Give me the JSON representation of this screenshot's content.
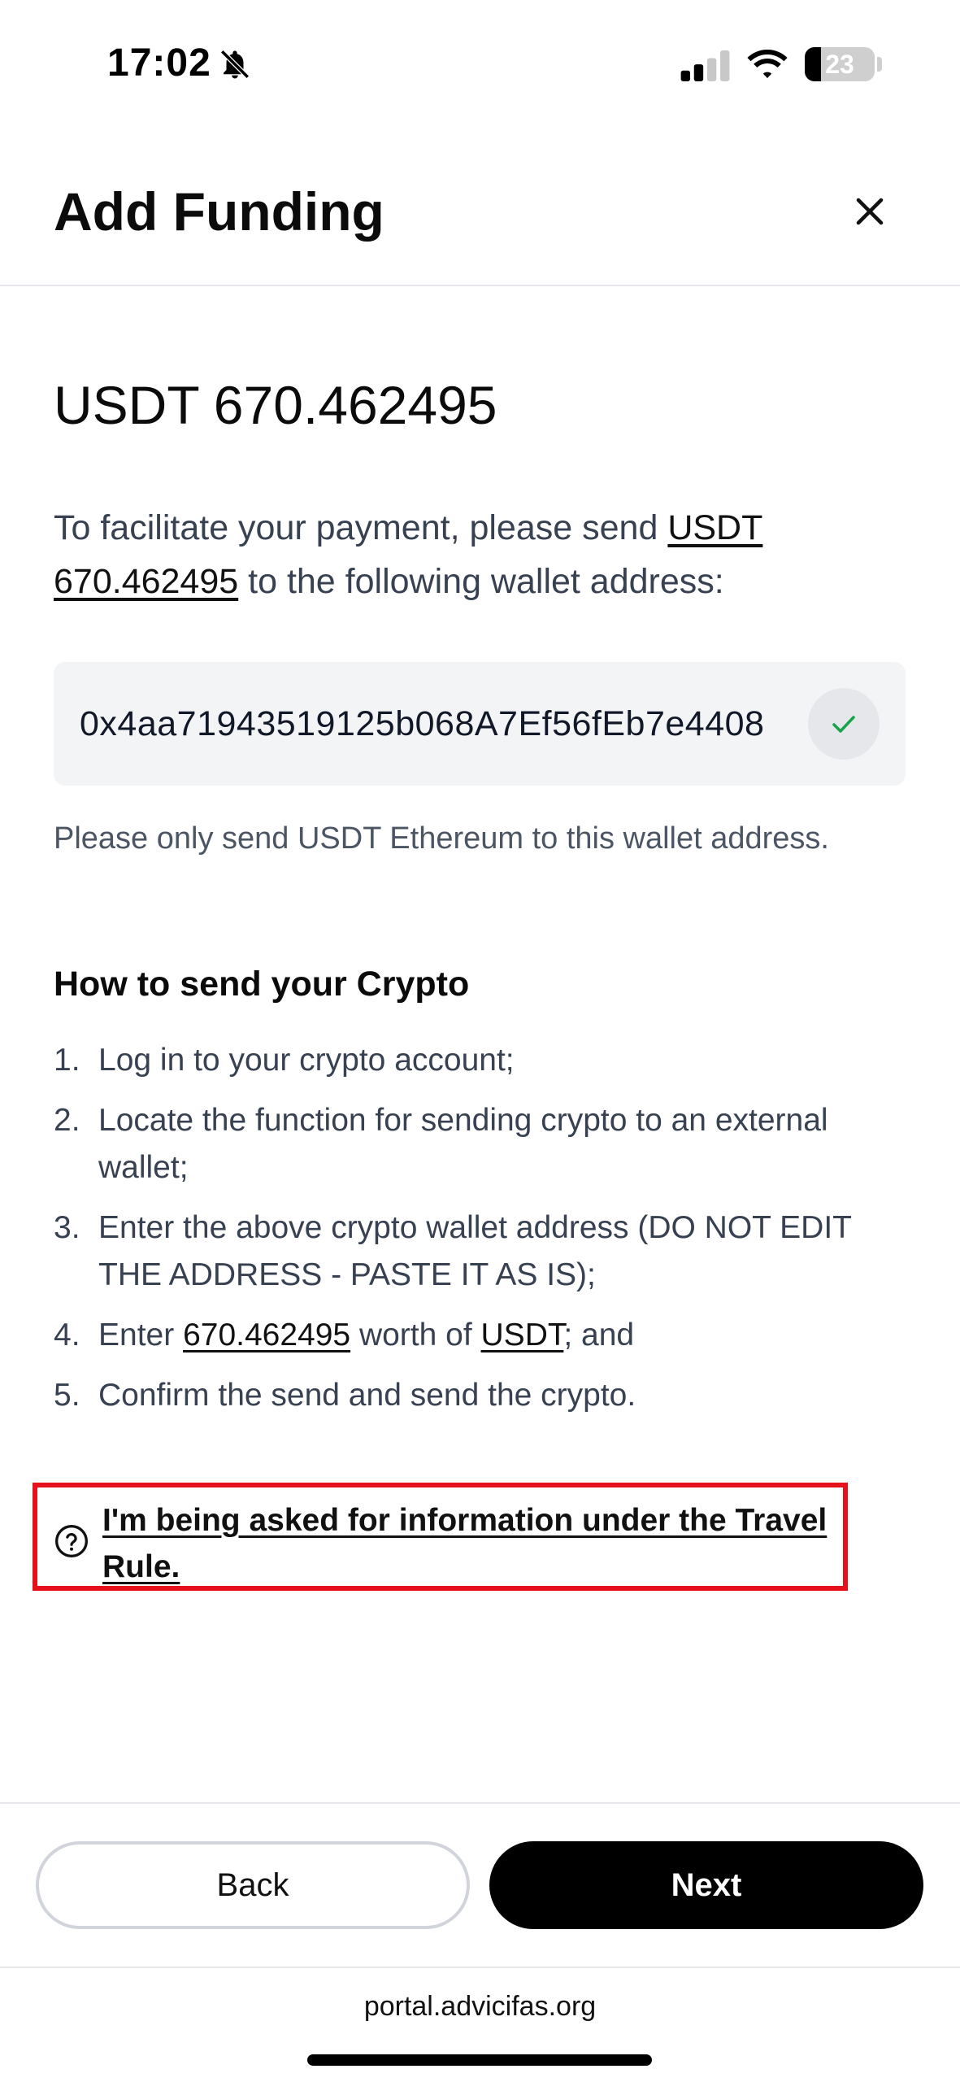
{
  "status_bar": {
    "time": "17:02",
    "battery": "23",
    "battery_level": 0.23,
    "icons": [
      "bell-slash-icon",
      "cellular-signal-icon",
      "wifi-icon",
      "battery-icon"
    ]
  },
  "header": {
    "title": "Add Funding",
    "close_icon": "close-icon"
  },
  "payment": {
    "amount_heading": "USDT 670.462495",
    "instruction_prefix": "To facilitate your payment, please send ",
    "instruction_link": "USDT 670.462495",
    "instruction_suffix": " to the following wallet address:",
    "wallet_address": "0x4aa71943519125b068A7Ef56fEb7e4408",
    "copy_icon": "check-icon",
    "wallet_note": "Please only send USDT Ethereum to this wallet address."
  },
  "how_to": {
    "title": "How to send your Crypto",
    "steps": [
      {
        "num": "1.",
        "text": "Log in to your crypto account;"
      },
      {
        "num": "2.",
        "text": "Locate the function for sending crypto to an external wallet;"
      },
      {
        "num": "3.",
        "text": "Enter the above crypto wallet address (DO NOT EDIT THE ADDRESS - PASTE IT AS IS);"
      },
      {
        "num": "4.",
        "text_prefix": "Enter ",
        "amount": "670.462495",
        "text_middle": " worth of ",
        "currency": "USDT",
        "text_suffix": "; and"
      },
      {
        "num": "5.",
        "text": "Confirm the send and send the crypto."
      }
    ]
  },
  "travel_rule": {
    "link_text": "I'm being asked for information under the Travel Rule.",
    "icon": "help-circle-icon",
    "highlight_color": "#e5121b"
  },
  "footer": {
    "back_label": "Back",
    "next_label": "Next"
  },
  "browser": {
    "url": "portal.advicifas.org"
  }
}
